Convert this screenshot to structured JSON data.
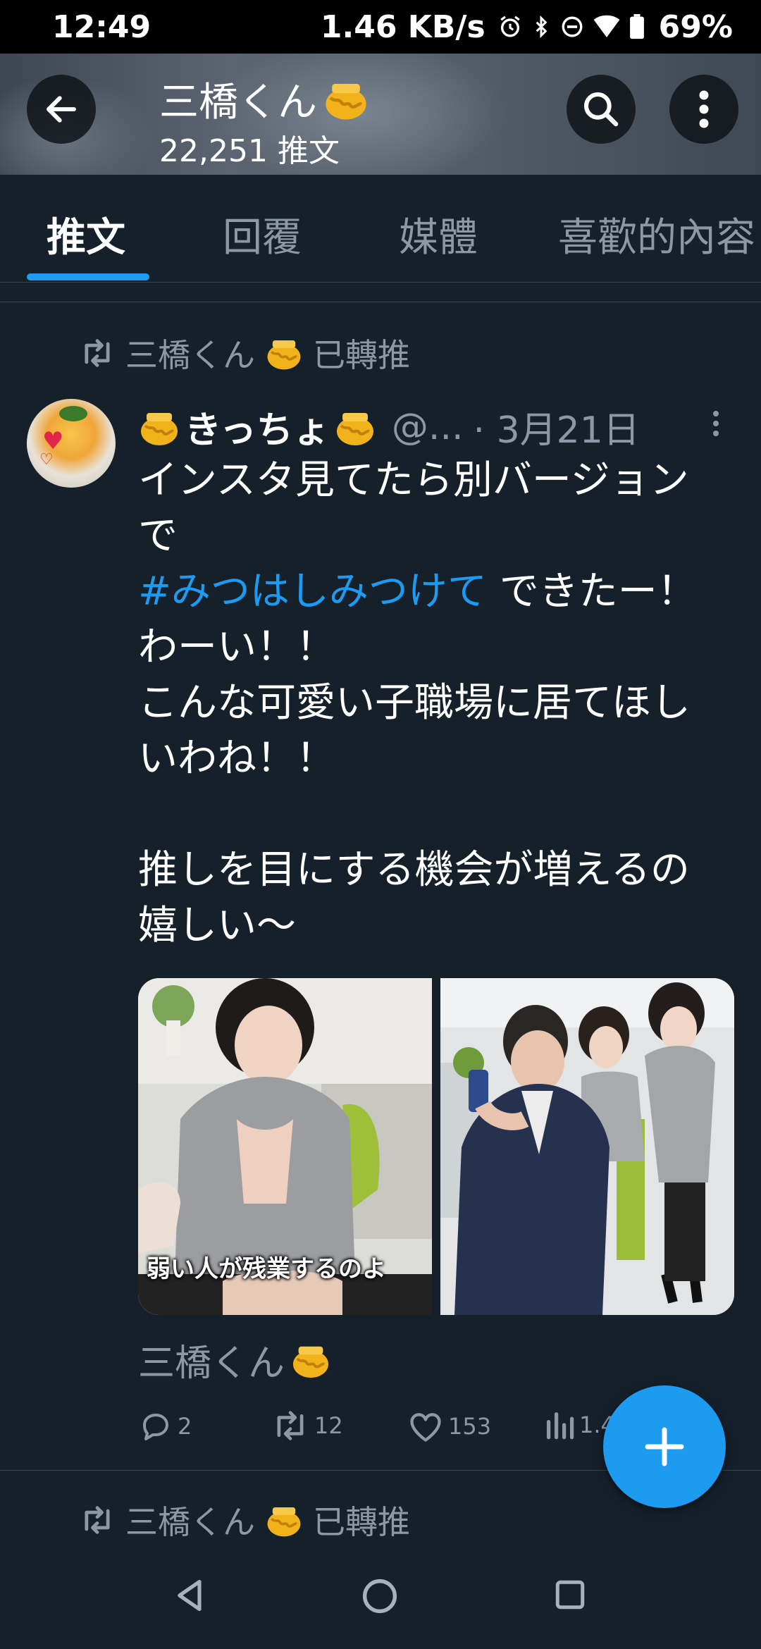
{
  "status_bar": {
    "time": "12:49",
    "network_speed": "1.46 KB/s",
    "icons": [
      "alarm-icon",
      "bluetooth-icon",
      "dnd-icon",
      "wifi-icon",
      "battery-icon"
    ],
    "battery": "69%"
  },
  "header": {
    "title": "三橋くん",
    "subtitle": "22,251 推文"
  },
  "tabs": [
    {
      "label": "推文",
      "active": true
    },
    {
      "label": "回覆",
      "active": false
    },
    {
      "label": "媒體",
      "active": false
    },
    {
      "label": "喜歡的內容",
      "active": false
    }
  ],
  "retweet_notice": {
    "user": "三橋くん",
    "action": "已轉推"
  },
  "tweet": {
    "author_name": "きっちょ",
    "handle": "@...",
    "date": "· 3月21日",
    "text_before": "インスタ見てたら別バージョン\nで\n",
    "hashtag": "#みつはしみつけて",
    "text_after": " できたー！\nわーい！！\nこんな可愛い子職場に居てほし\nいわね！！\n\n推しを目にする機会が増えるの\n嬉しい〜",
    "image_caption": "弱い人が残業するのよ",
    "by_line": "三橋くん",
    "reply_count": "2",
    "retweet_count": "12",
    "like_count": "153",
    "view_count": "1.4"
  },
  "next_retweet_notice": {
    "user": "三橋くん",
    "action": "已轉推"
  },
  "colors": {
    "background": "#15202b",
    "accent": "#1d9bf0",
    "muted": "#8b98a5"
  }
}
